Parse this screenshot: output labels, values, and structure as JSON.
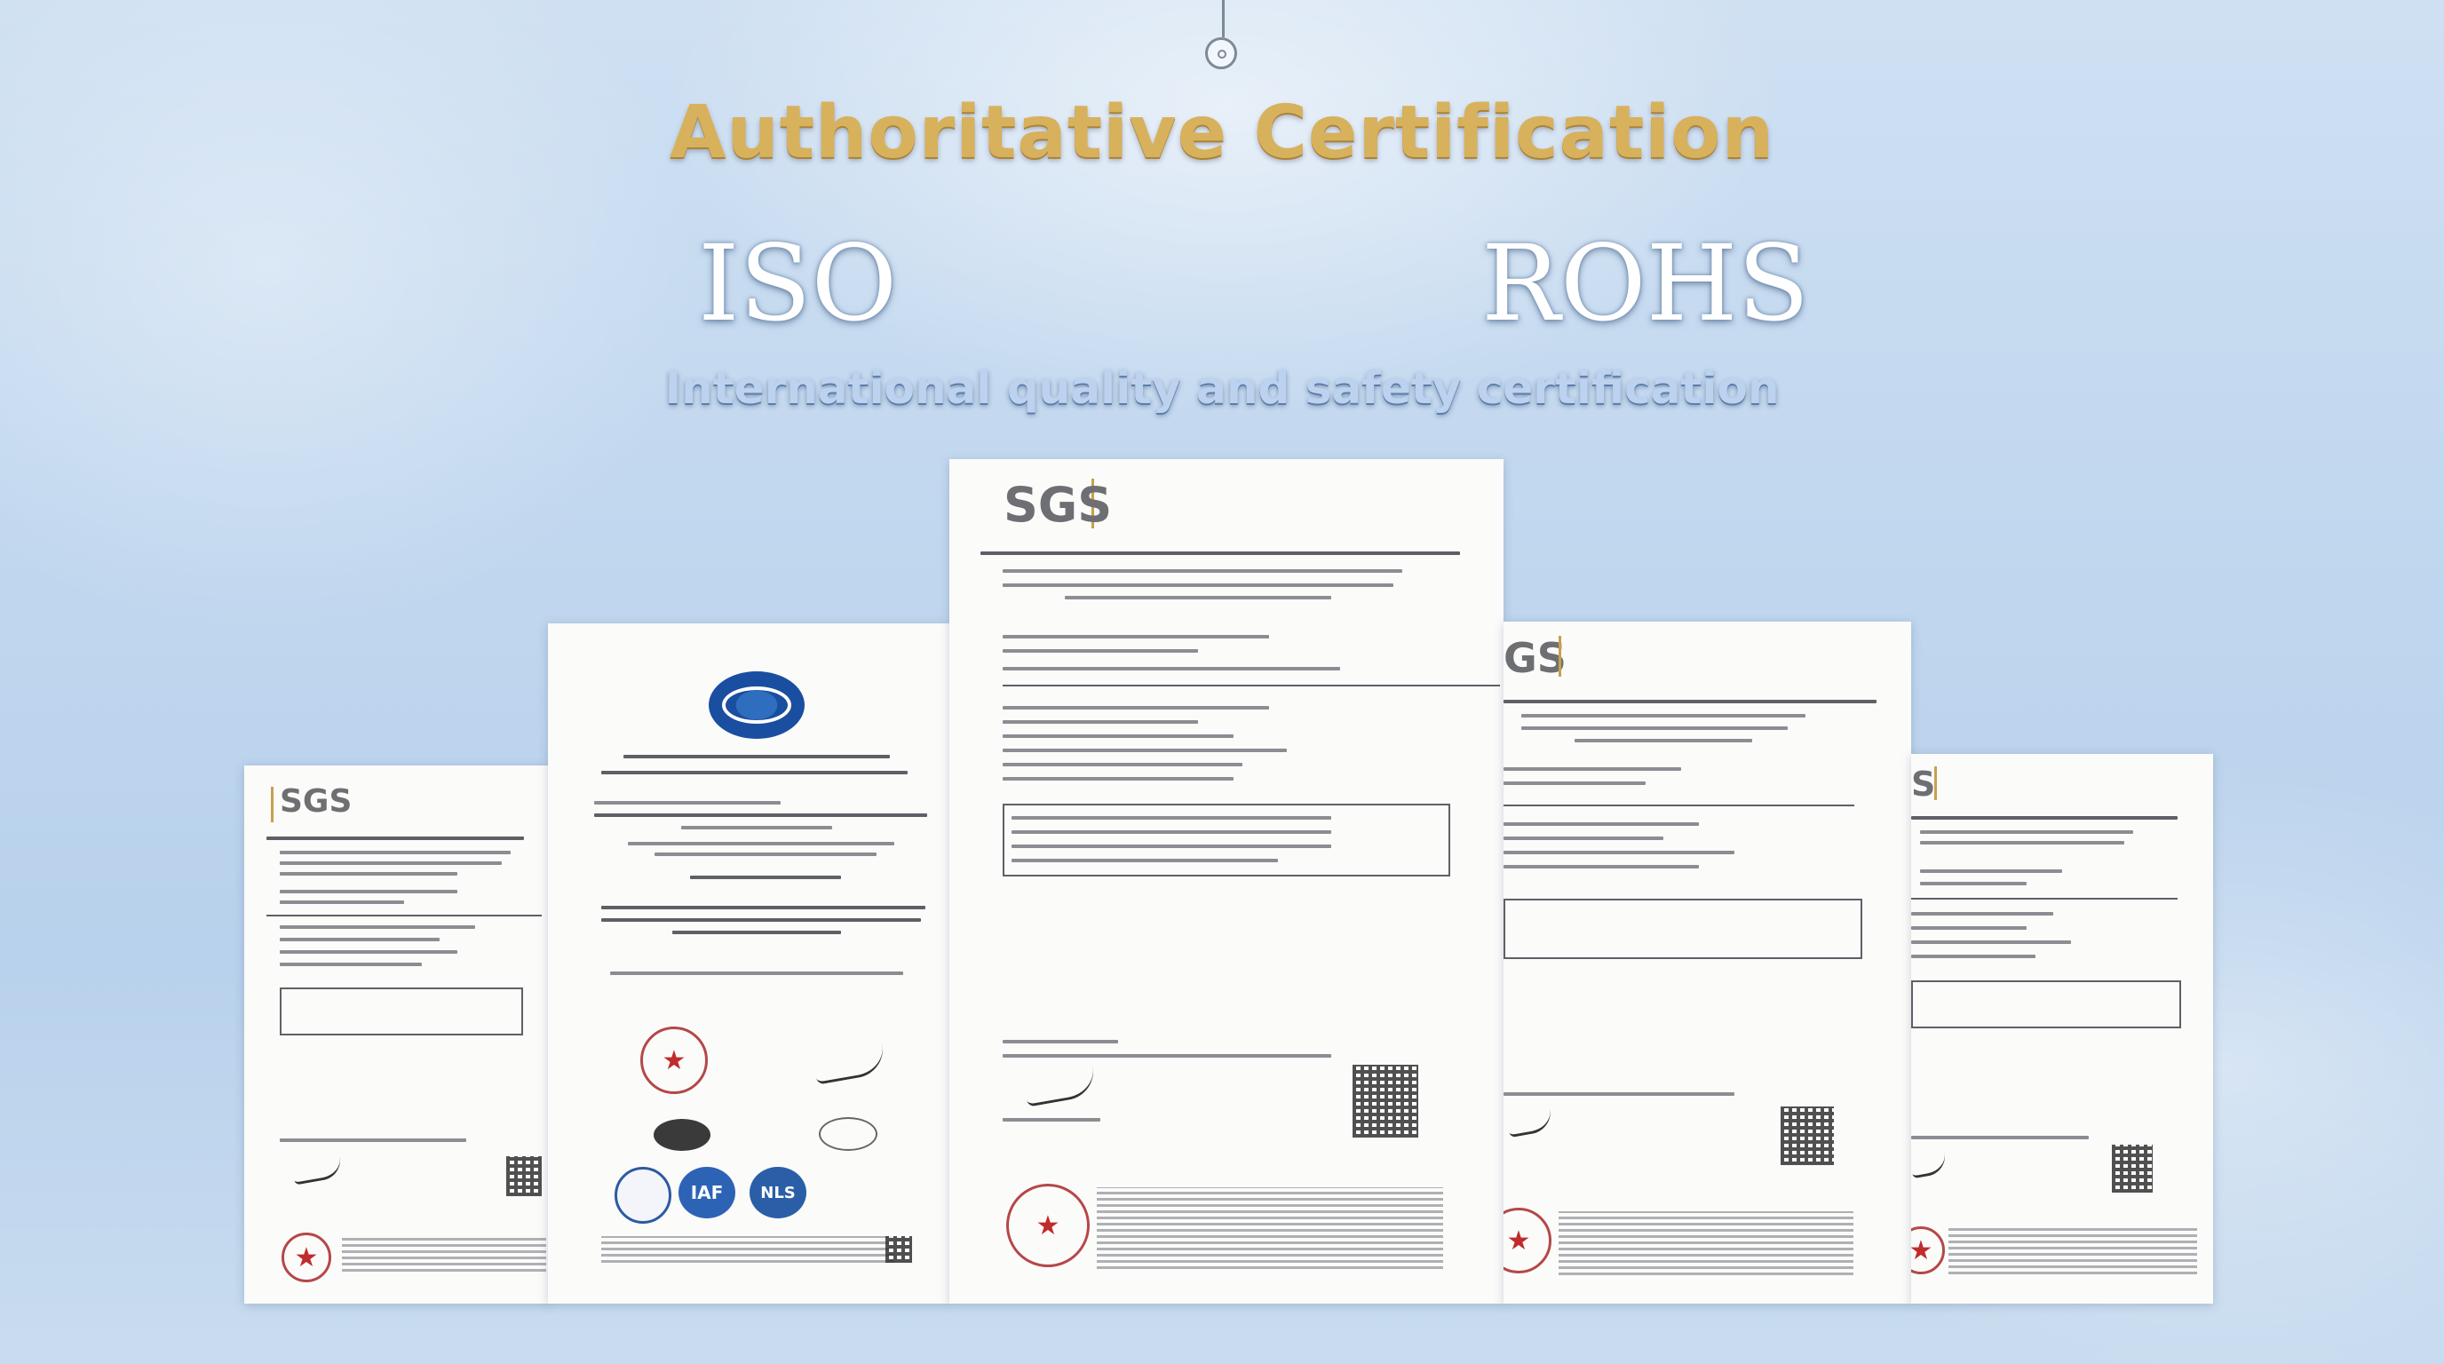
{
  "heading": {
    "title": "Authoritative Certification",
    "iso": "ISO",
    "rohs": "ROHS",
    "subtitle": "International quality and safety certification"
  },
  "certificates": {
    "sgs_logo": "SGS",
    "sgs_partial_logo_1": "GS",
    "sgs_partial_logo_2": "S",
    "iaf_mark": "IAF",
    "accreditation_mark": "NLS"
  },
  "colors": {
    "title_gold": "#d8b15c",
    "background_blue": "#c2d8ef",
    "stamp_red": "#c02c2c"
  },
  "icons": [
    "hanger-icon",
    "globe-emblem-icon",
    "star-stamp-icon",
    "qr-code-icon",
    "signature-icon"
  ]
}
